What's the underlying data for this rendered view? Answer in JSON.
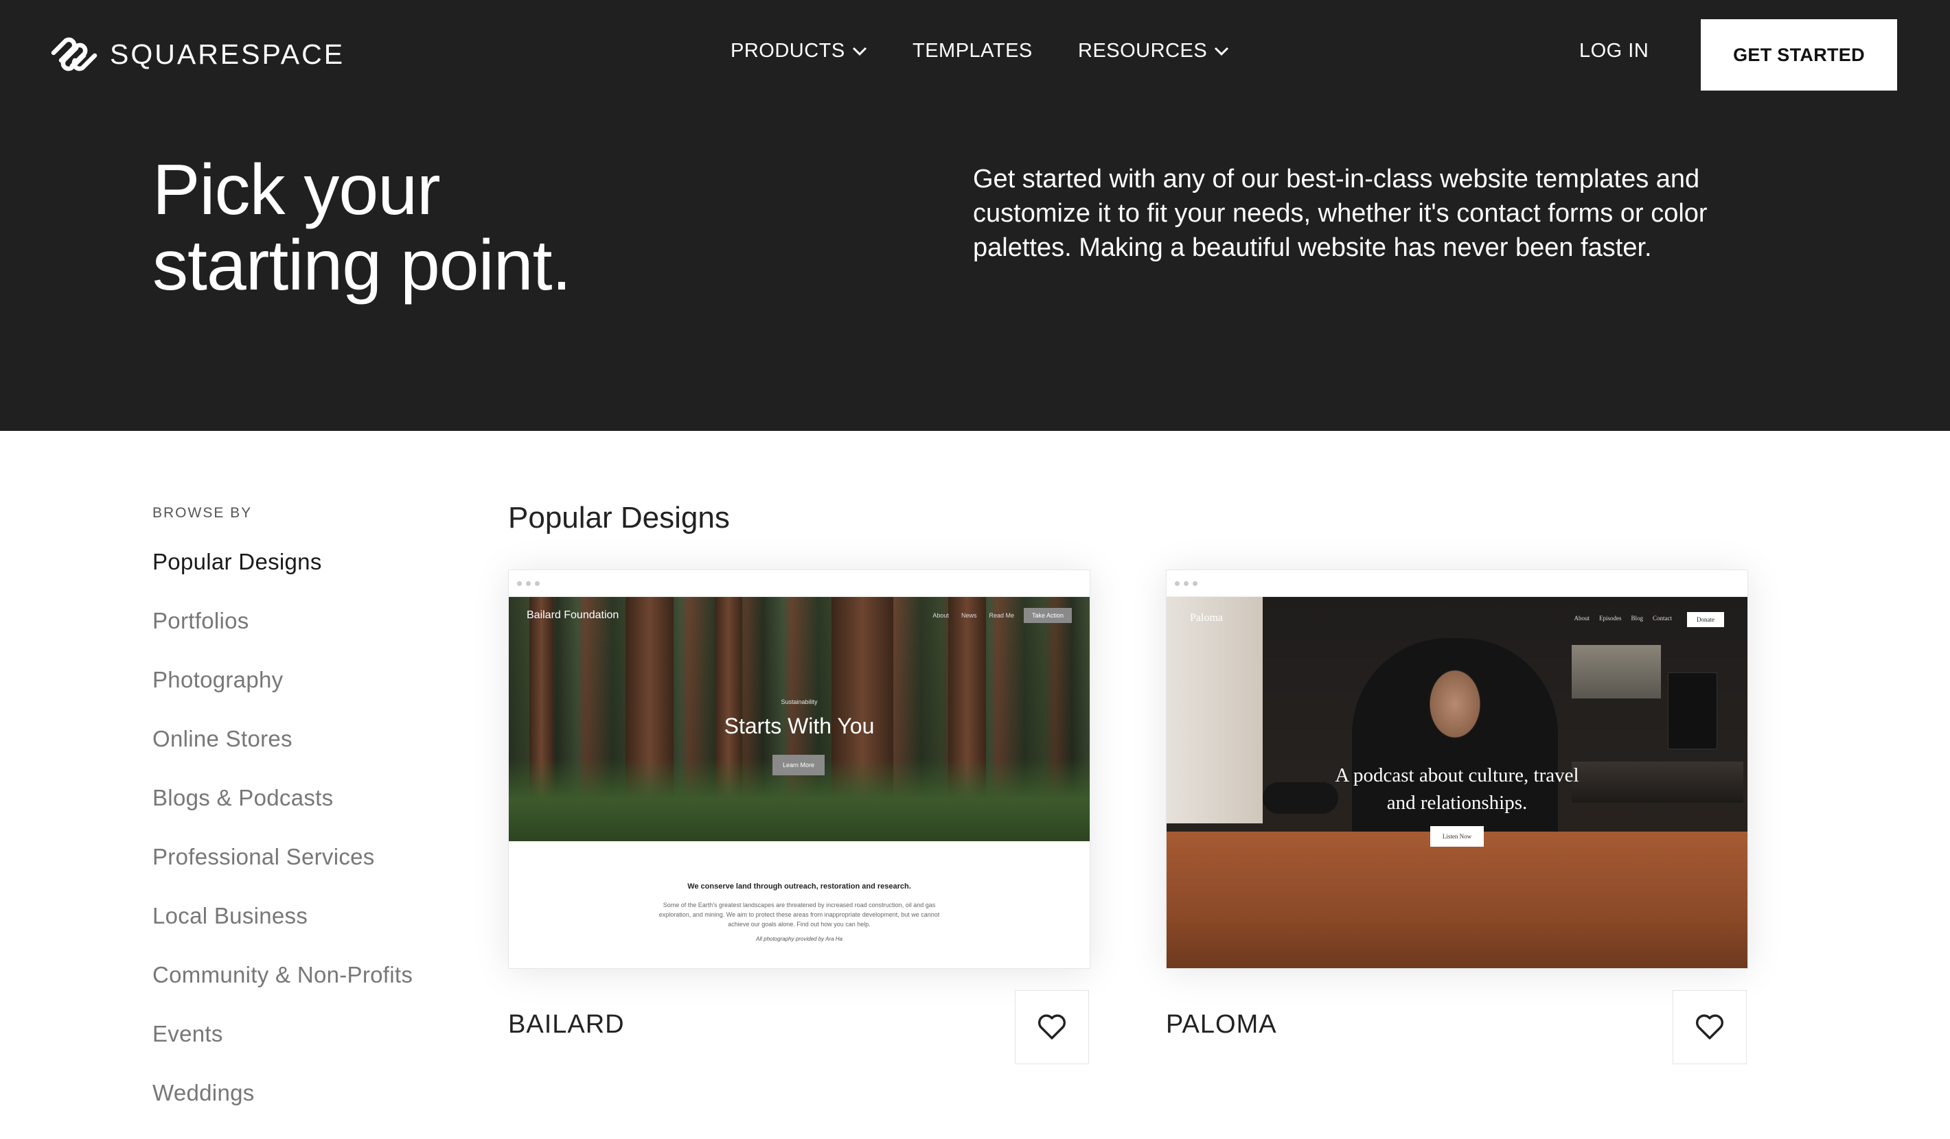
{
  "nav": {
    "brand": "SQUARESPACE",
    "items": [
      {
        "label": "PRODUCTS",
        "has_dropdown": true
      },
      {
        "label": "TEMPLATES",
        "has_dropdown": false
      },
      {
        "label": "RESOURCES",
        "has_dropdown": true
      }
    ],
    "login": "LOG IN",
    "cta": "GET STARTED"
  },
  "hero": {
    "title_line1": "Pick your",
    "title_line2": "starting point.",
    "description": "Get started with any of our best-in-class website templates and customize it to fit your needs, whether it's contact forms or color palettes. Making a beautiful website has never been faster."
  },
  "sidebar": {
    "label": "BROWSE BY",
    "items": [
      {
        "label": "Popular Designs",
        "active": true
      },
      {
        "label": "Portfolios"
      },
      {
        "label": "Photography"
      },
      {
        "label": "Online Stores"
      },
      {
        "label": "Blogs & Podcasts"
      },
      {
        "label": "Professional Services"
      },
      {
        "label": "Local Business"
      },
      {
        "label": "Community & Non-Profits"
      },
      {
        "label": "Events"
      },
      {
        "label": "Weddings"
      }
    ]
  },
  "main": {
    "section_title": "Popular Designs",
    "templates": [
      {
        "name": "BAILARD",
        "preview": {
          "brand": "Bailard Foundation",
          "nav": [
            "About",
            "News",
            "Read Me"
          ],
          "nav_button": "Take Action",
          "kicker": "Sustainability",
          "headline": "Starts With You",
          "cta": "Learn More",
          "body_heading": "We conserve land through outreach, restoration and research.",
          "body_text": "Some of the Earth's greatest landscapes are threatened by increased road construction, oil and gas exploration, and mining. We aim to protect these areas from inappropriate development, but we cannot achieve our goals alone. Find out how you can help.",
          "credit": "All photography provided by Ara Ha"
        }
      },
      {
        "name": "PALOMA",
        "preview": {
          "brand": "Paloma",
          "nav": [
            "About",
            "Episodes",
            "Blog",
            "Contact"
          ],
          "nav_button": "Donate",
          "headline_line1": "A podcast about culture, travel",
          "headline_line2": "and relationships.",
          "cta": "Listen Now"
        }
      }
    ]
  }
}
